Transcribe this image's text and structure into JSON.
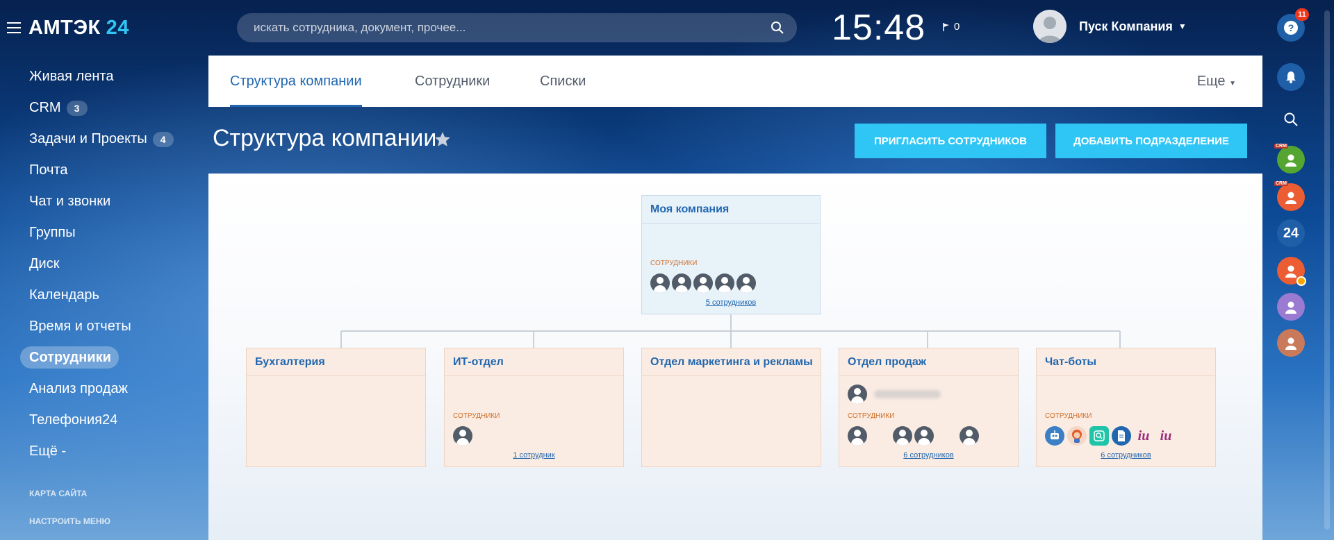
{
  "header": {
    "logo_name": "АМТЭК",
    "logo_number": "24",
    "search_placeholder": "искать сотрудника, документ, прочее...",
    "clock": "15:48",
    "flag_count": "0",
    "user_name": "Пуск Компания"
  },
  "sidebar": {
    "items": [
      {
        "label": "Живая лента"
      },
      {
        "label": "CRM",
        "badge": "3"
      },
      {
        "label": "Задачи и Проекты",
        "badge": "4"
      },
      {
        "label": "Почта"
      },
      {
        "label": "Чат и звонки"
      },
      {
        "label": "Группы"
      },
      {
        "label": "Диск"
      },
      {
        "label": "Календарь"
      },
      {
        "label": "Время и отчеты"
      },
      {
        "label": "Сотрудники",
        "active": true
      },
      {
        "label": "Анализ продаж"
      },
      {
        "label": "Телефония24"
      },
      {
        "label": "Ещё -"
      }
    ],
    "sitemap": "КАРТА САЙТА",
    "configure": "НАСТРОИТЬ МЕНЮ"
  },
  "tabs": {
    "items": [
      "Структура компании",
      "Сотрудники",
      "Списки"
    ],
    "more": "Еще"
  },
  "page": {
    "title": "Структура компании",
    "invite_button": "ПРИГЛАСИТЬ СОТРУДНИКОВ",
    "add_button": "ДОБАВИТЬ ПОДРАЗДЕЛЕНИЕ"
  },
  "structure": {
    "root": {
      "name": "Моя компания",
      "employees_label": "СОТРУДНИКИ",
      "count": "5 сотрудников"
    },
    "departments": [
      {
        "name": "Бухгалтерия"
      },
      {
        "name": "ИТ-отдел",
        "employees_label": "СОТРУДНИКИ",
        "count": "1 сотрудник"
      },
      {
        "name": "Отдел маркетинга и рекламы"
      },
      {
        "name": "Отдел продаж",
        "employees_label": "СОТРУДНИКИ",
        "count": "6 сотрудников"
      },
      {
        "name": "Чат-боты",
        "employees_label": "СОТРУДНИКИ",
        "count": "6 сотрудников"
      }
    ]
  },
  "rightpanel": {
    "help_badge": "11",
    "crm_tag": "CRM",
    "b24_label": "24"
  },
  "colors": {
    "accent": "#2fc6f6",
    "link": "#2067b0",
    "dept_bg": "#fbece3",
    "root_bg": "#e8f2f9"
  }
}
